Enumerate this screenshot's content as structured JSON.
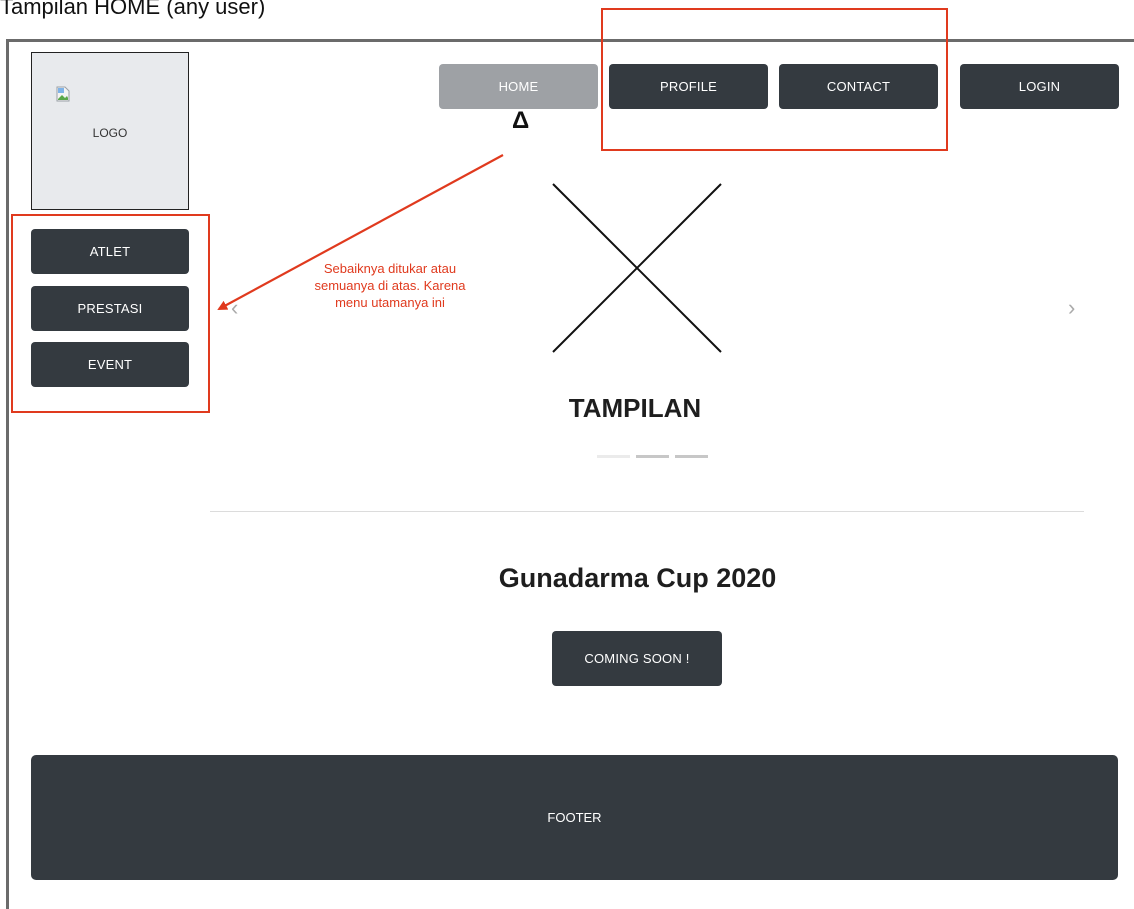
{
  "caption": "Tampilan HOME (any user)",
  "logo": {
    "text": "LOGO",
    "icon": "broken-image-icon"
  },
  "sidebar": {
    "items": [
      {
        "label": "ATLET"
      },
      {
        "label": "PRESTASI"
      },
      {
        "label": "EVENT"
      }
    ]
  },
  "nav": {
    "items": [
      {
        "label": "HOME",
        "active": true
      },
      {
        "label": "PROFILE",
        "active": false
      },
      {
        "label": "CONTACT",
        "active": false
      },
      {
        "label": "LOGIN",
        "active": false
      }
    ]
  },
  "annotation": {
    "text": "Sebaiknya ditukar atau semuanya  di atas. Karena menu utamanya ini",
    "color": "#e03a1e"
  },
  "cursor_mark": "Δ",
  "carousel": {
    "title": "TAMPILAN",
    "prev_icon": "chevron-left-icon",
    "next_icon": "chevron-right-icon",
    "prev_glyph": "‹",
    "next_glyph": "›",
    "indicator_count": 3,
    "active_index": 0
  },
  "event": {
    "title": "Gunadarma Cup 2020",
    "button_label": "COMING SOON !"
  },
  "footer": {
    "label": "FOOTER"
  },
  "colors": {
    "dark_button": "#343a40",
    "active_button": "#9ea1a5",
    "annotation_red": "#e03a1e"
  }
}
